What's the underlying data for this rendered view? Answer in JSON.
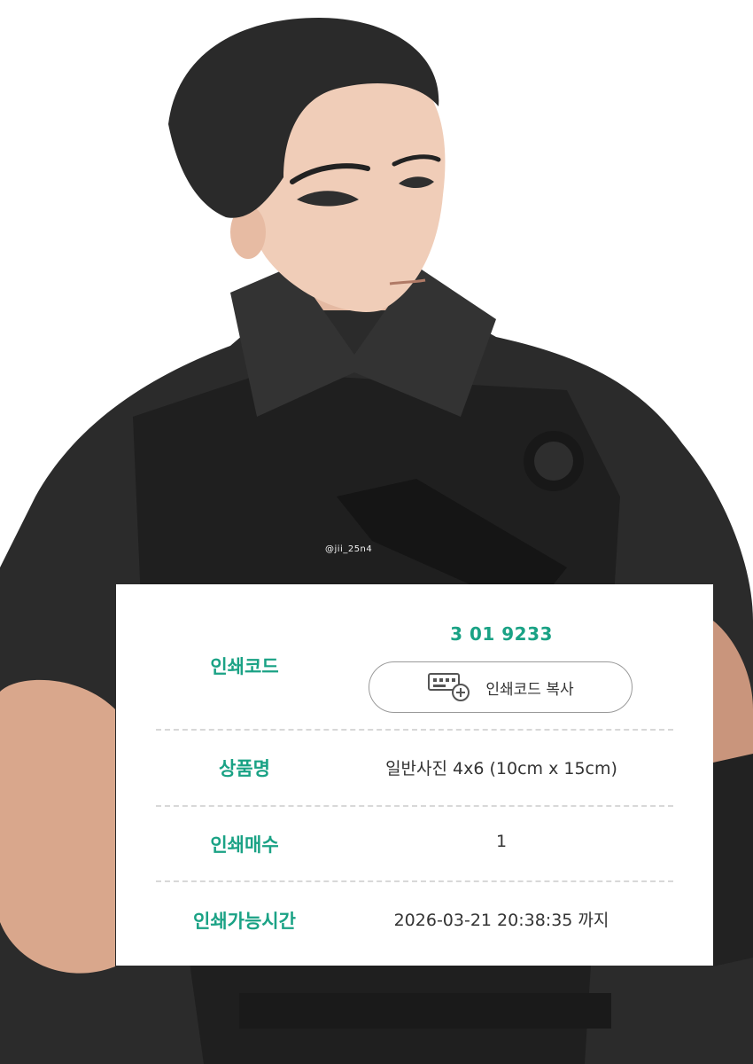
{
  "watermark": "@jii_25n4",
  "print_info": {
    "code_label": "인쇄코드",
    "code_value": "3 01 9233",
    "copy_button_label": "인쇄코드 복사",
    "product_label": "상품명",
    "product_value": "일반사진 4x6 (10cm x 15cm)",
    "count_label": "인쇄매수",
    "count_value": "1",
    "deadline_label": "인쇄가능시간",
    "deadline_value": "2026-03-21 20:38:35 까지"
  },
  "colors": {
    "accent": "#1aa285",
    "text": "#333333",
    "divider": "#d8d8d8"
  }
}
